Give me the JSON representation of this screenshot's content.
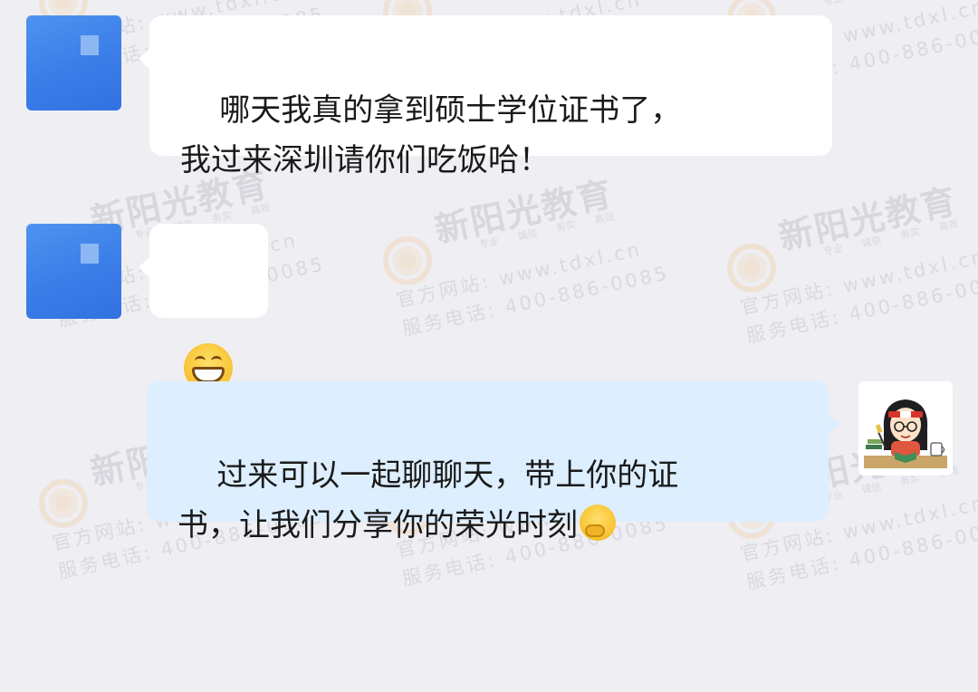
{
  "watermark": {
    "brand": "新阳光教育",
    "tags": "专业 诚信 务实 高效",
    "line1": "官方网站: www.tdxl.cn",
    "line2": "服务电话: 400-886-0085"
  },
  "messages": [
    {
      "side": "incoming",
      "text": "哪天我真的拿到硕士学位证书了，\n我过来深圳请你们吃饭哈！"
    },
    {
      "side": "incoming",
      "emoji": "grinning-face-icon"
    },
    {
      "side": "outgoing",
      "text_line1": "过来可以一起聊聊天，带上你的证",
      "text_line2": "书，让我们分享你的荣光时刻",
      "trailing_emoji": "face-with-hand-over-mouth-icon"
    }
  ]
}
